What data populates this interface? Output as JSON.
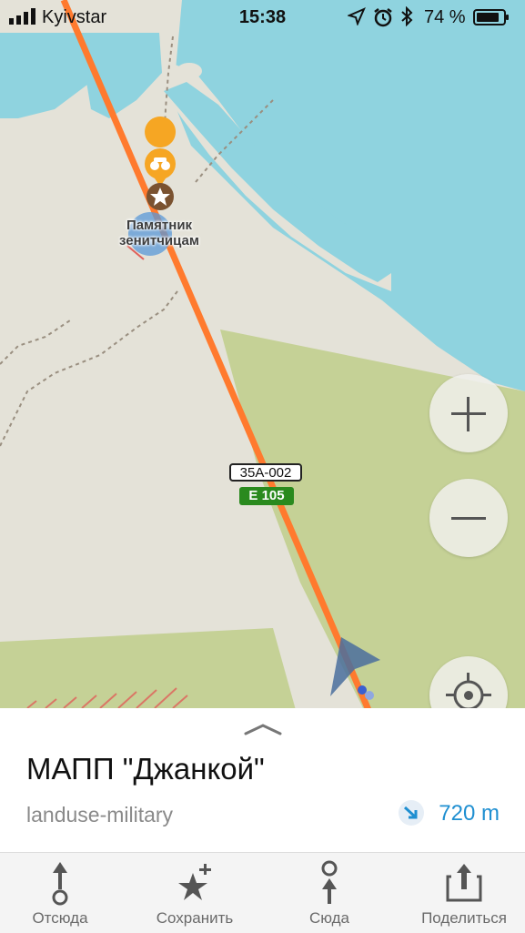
{
  "status_bar": {
    "carrier": "Kyivstar",
    "time": "15:38",
    "battery": "74 %"
  },
  "map": {
    "poi_label": "Памятник\nзенитчицам",
    "road_ref": "35А-002",
    "route_ref": "E 105"
  },
  "sheet": {
    "title": "МАПП \"Джанкой\"",
    "type": "landuse-military",
    "distance": "720 m"
  },
  "toolbar": {
    "from": "Отсюда",
    "save": "Сохранить",
    "to": "Сюда",
    "share": "Поделиться"
  }
}
